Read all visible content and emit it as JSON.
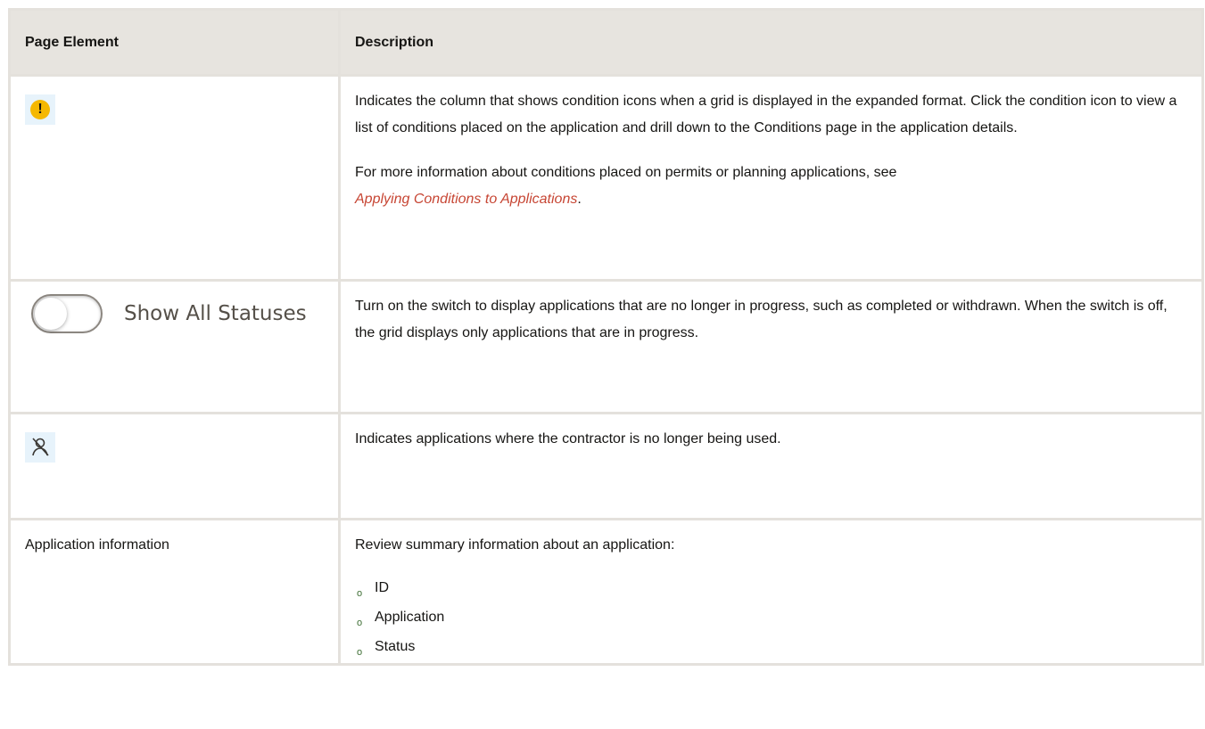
{
  "table": {
    "headers": {
      "element": "Page Element",
      "description": "Description"
    },
    "rows": [
      {
        "element_icon": "warning-condition-icon",
        "icon_glyph": "!",
        "paragraph1": "Indicates the column that shows condition icons when a grid is displayed in the expanded format. Click the condition icon to view a list of conditions placed on the application and drill down to the Conditions page in the application details.",
        "paragraph2_prefix": "For more information about conditions placed on permits or planning applications, see",
        "link_text": "Applying Conditions to Applications",
        "paragraph2_suffix": "."
      },
      {
        "element_icon": "toggle-switch-icon",
        "toggle_label": "Show All Statuses",
        "toggle_state": "off",
        "description": "Turn on the switch to display applications that are no longer in progress, such as completed or withdrawn. When the switch is off, the grid displays only applications that are in progress."
      },
      {
        "element_icon": "contractor-not-used-icon",
        "description": "Indicates applications where the contractor is no longer being used."
      },
      {
        "element_text": "Application information",
        "description": "Review summary information about an application:",
        "items": [
          "ID",
          "Application",
          "Status"
        ]
      }
    ]
  },
  "colors": {
    "border": "#e4e1dc",
    "header_bg": "#e7e4df",
    "link": "#c74634",
    "warning": "#f5b800",
    "icon_bg": "#e7f3fb"
  }
}
